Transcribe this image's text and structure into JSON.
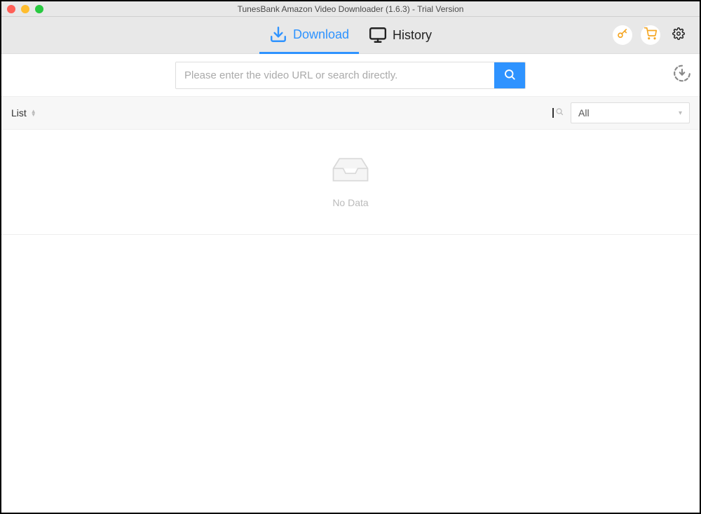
{
  "window": {
    "title": "TunesBank Amazon Video Downloader (1.6.3) - Trial Version"
  },
  "tabs": {
    "download": "Download",
    "history": "History"
  },
  "search": {
    "placeholder": "Please enter the video URL or search directly."
  },
  "listbar": {
    "label": "List",
    "filter_selected": "All"
  },
  "empty": {
    "message": "No Data"
  },
  "colors": {
    "accent": "#2e93ff",
    "key_icon": "#f5a623",
    "cart_icon": "#f5a623"
  }
}
